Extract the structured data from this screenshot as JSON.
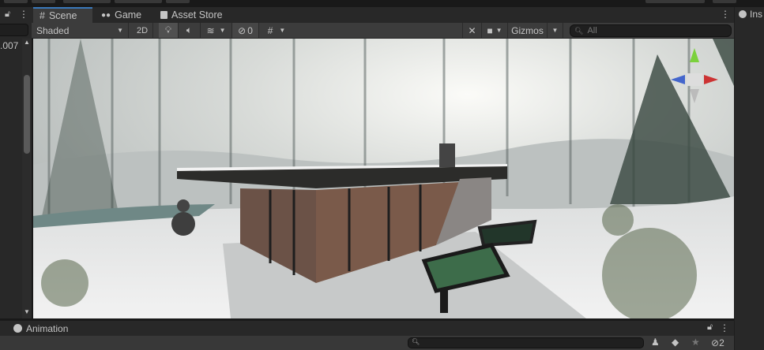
{
  "left_panel": {
    "value_fragment": ".007"
  },
  "tabs": [
    {
      "label": "Scene",
      "icon": "grid-hash-icon"
    },
    {
      "label": "Game",
      "icon": "gamepad-icon"
    },
    {
      "label": "Asset Store",
      "icon": "shopping-bag-icon"
    }
  ],
  "toolbar": {
    "shading_mode": "Shaded",
    "mode_2d": "2D",
    "hidden_count": "0",
    "gizmos": "Gizmos",
    "search_placeholder": "All"
  },
  "inspector": {
    "tab_label": "Ins"
  },
  "animation": {
    "title": "Animation",
    "hidden_count": "2"
  },
  "colors": {
    "accent": "#3a79bb",
    "panel": "#282828",
    "toolbar": "#3c3c3c"
  }
}
